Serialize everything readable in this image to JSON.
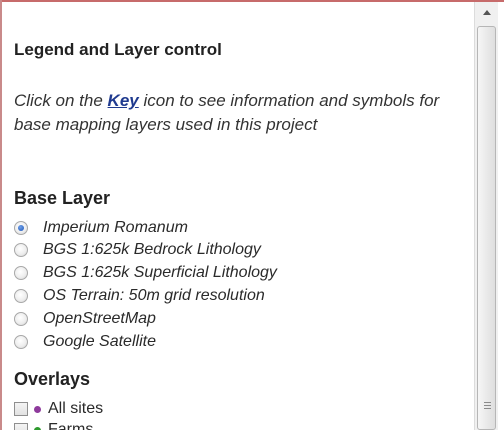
{
  "panel": {
    "title": "Legend and Layer control",
    "intro_before": "Click on the ",
    "intro_link": "Key",
    "intro_after": " icon to see information and symbols for base mapping layers used in this project"
  },
  "base_layer": {
    "title": "Base Layer",
    "selected": "Imperium Romanum",
    "options": [
      {
        "label": "Imperium Romanum",
        "checked": true
      },
      {
        "label": "BGS 1:625k Bedrock Lithology",
        "checked": false
      },
      {
        "label": "BGS 1:625k Superficial Lithology",
        "checked": false
      },
      {
        "label": "OS Terrain: 50m grid resolution",
        "checked": false
      },
      {
        "label": "OpenStreetMap",
        "checked": false
      },
      {
        "label": "Google Satellite",
        "checked": false
      }
    ]
  },
  "overlays": {
    "title": "Overlays",
    "items": [
      {
        "label": "All sites",
        "checked": false,
        "dot_color": "#8e3a9c"
      },
      {
        "label": "Farms",
        "checked": false,
        "dot_color": "#2e9a2e"
      }
    ]
  },
  "colors": {
    "link": "#1f3a8f",
    "radio_selected": "#1d56b8"
  },
  "icons": {
    "scroll_up": "triangle-up",
    "thumb_grip": "three-lines"
  }
}
